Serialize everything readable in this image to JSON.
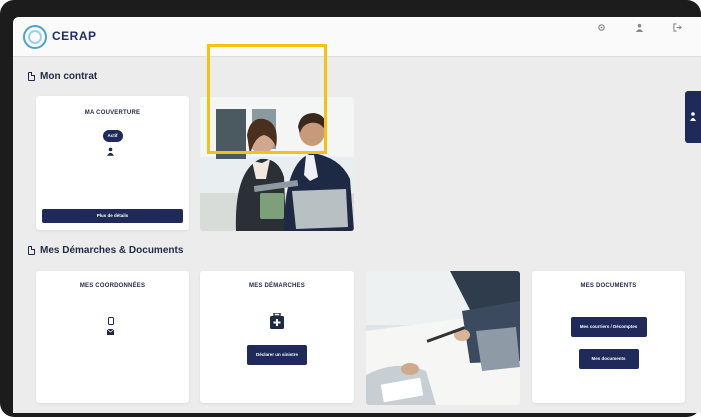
{
  "header": {
    "brand": "CERAP",
    "brand_tagline": "",
    "actions": [
      {
        "icon": "gear-icon",
        "label": ""
      },
      {
        "icon": "user-icon",
        "label": ""
      },
      {
        "icon": "logout-icon",
        "label": ""
      }
    ]
  },
  "contract_section": {
    "title": "Mon contrat",
    "coverage_card": {
      "title": "MA COUVERTURE",
      "line1": "",
      "line2": "",
      "line3": "",
      "badge": "Actif",
      "beneficiaries": "",
      "details_button": "Plus de détails"
    }
  },
  "documents_section": {
    "title": "Mes Démarches & Documents",
    "coordinates_card": {
      "title": "MES COORDONNÉES",
      "name": "",
      "phone": "",
      "email": "",
      "profile_link": ""
    },
    "procedures_card": {
      "title": "MES DÉMARCHES",
      "button": "Déclarer un sinistre"
    },
    "documents_card": {
      "title": "MES DOCUMENTS",
      "button_primary": "Mes courriers / Décomptes",
      "button_secondary": "Mes documents"
    }
  },
  "colors": {
    "brand_navy": "#1f2a5a",
    "highlight": "#f5c211",
    "logo_blue": "#4aa5c8"
  }
}
